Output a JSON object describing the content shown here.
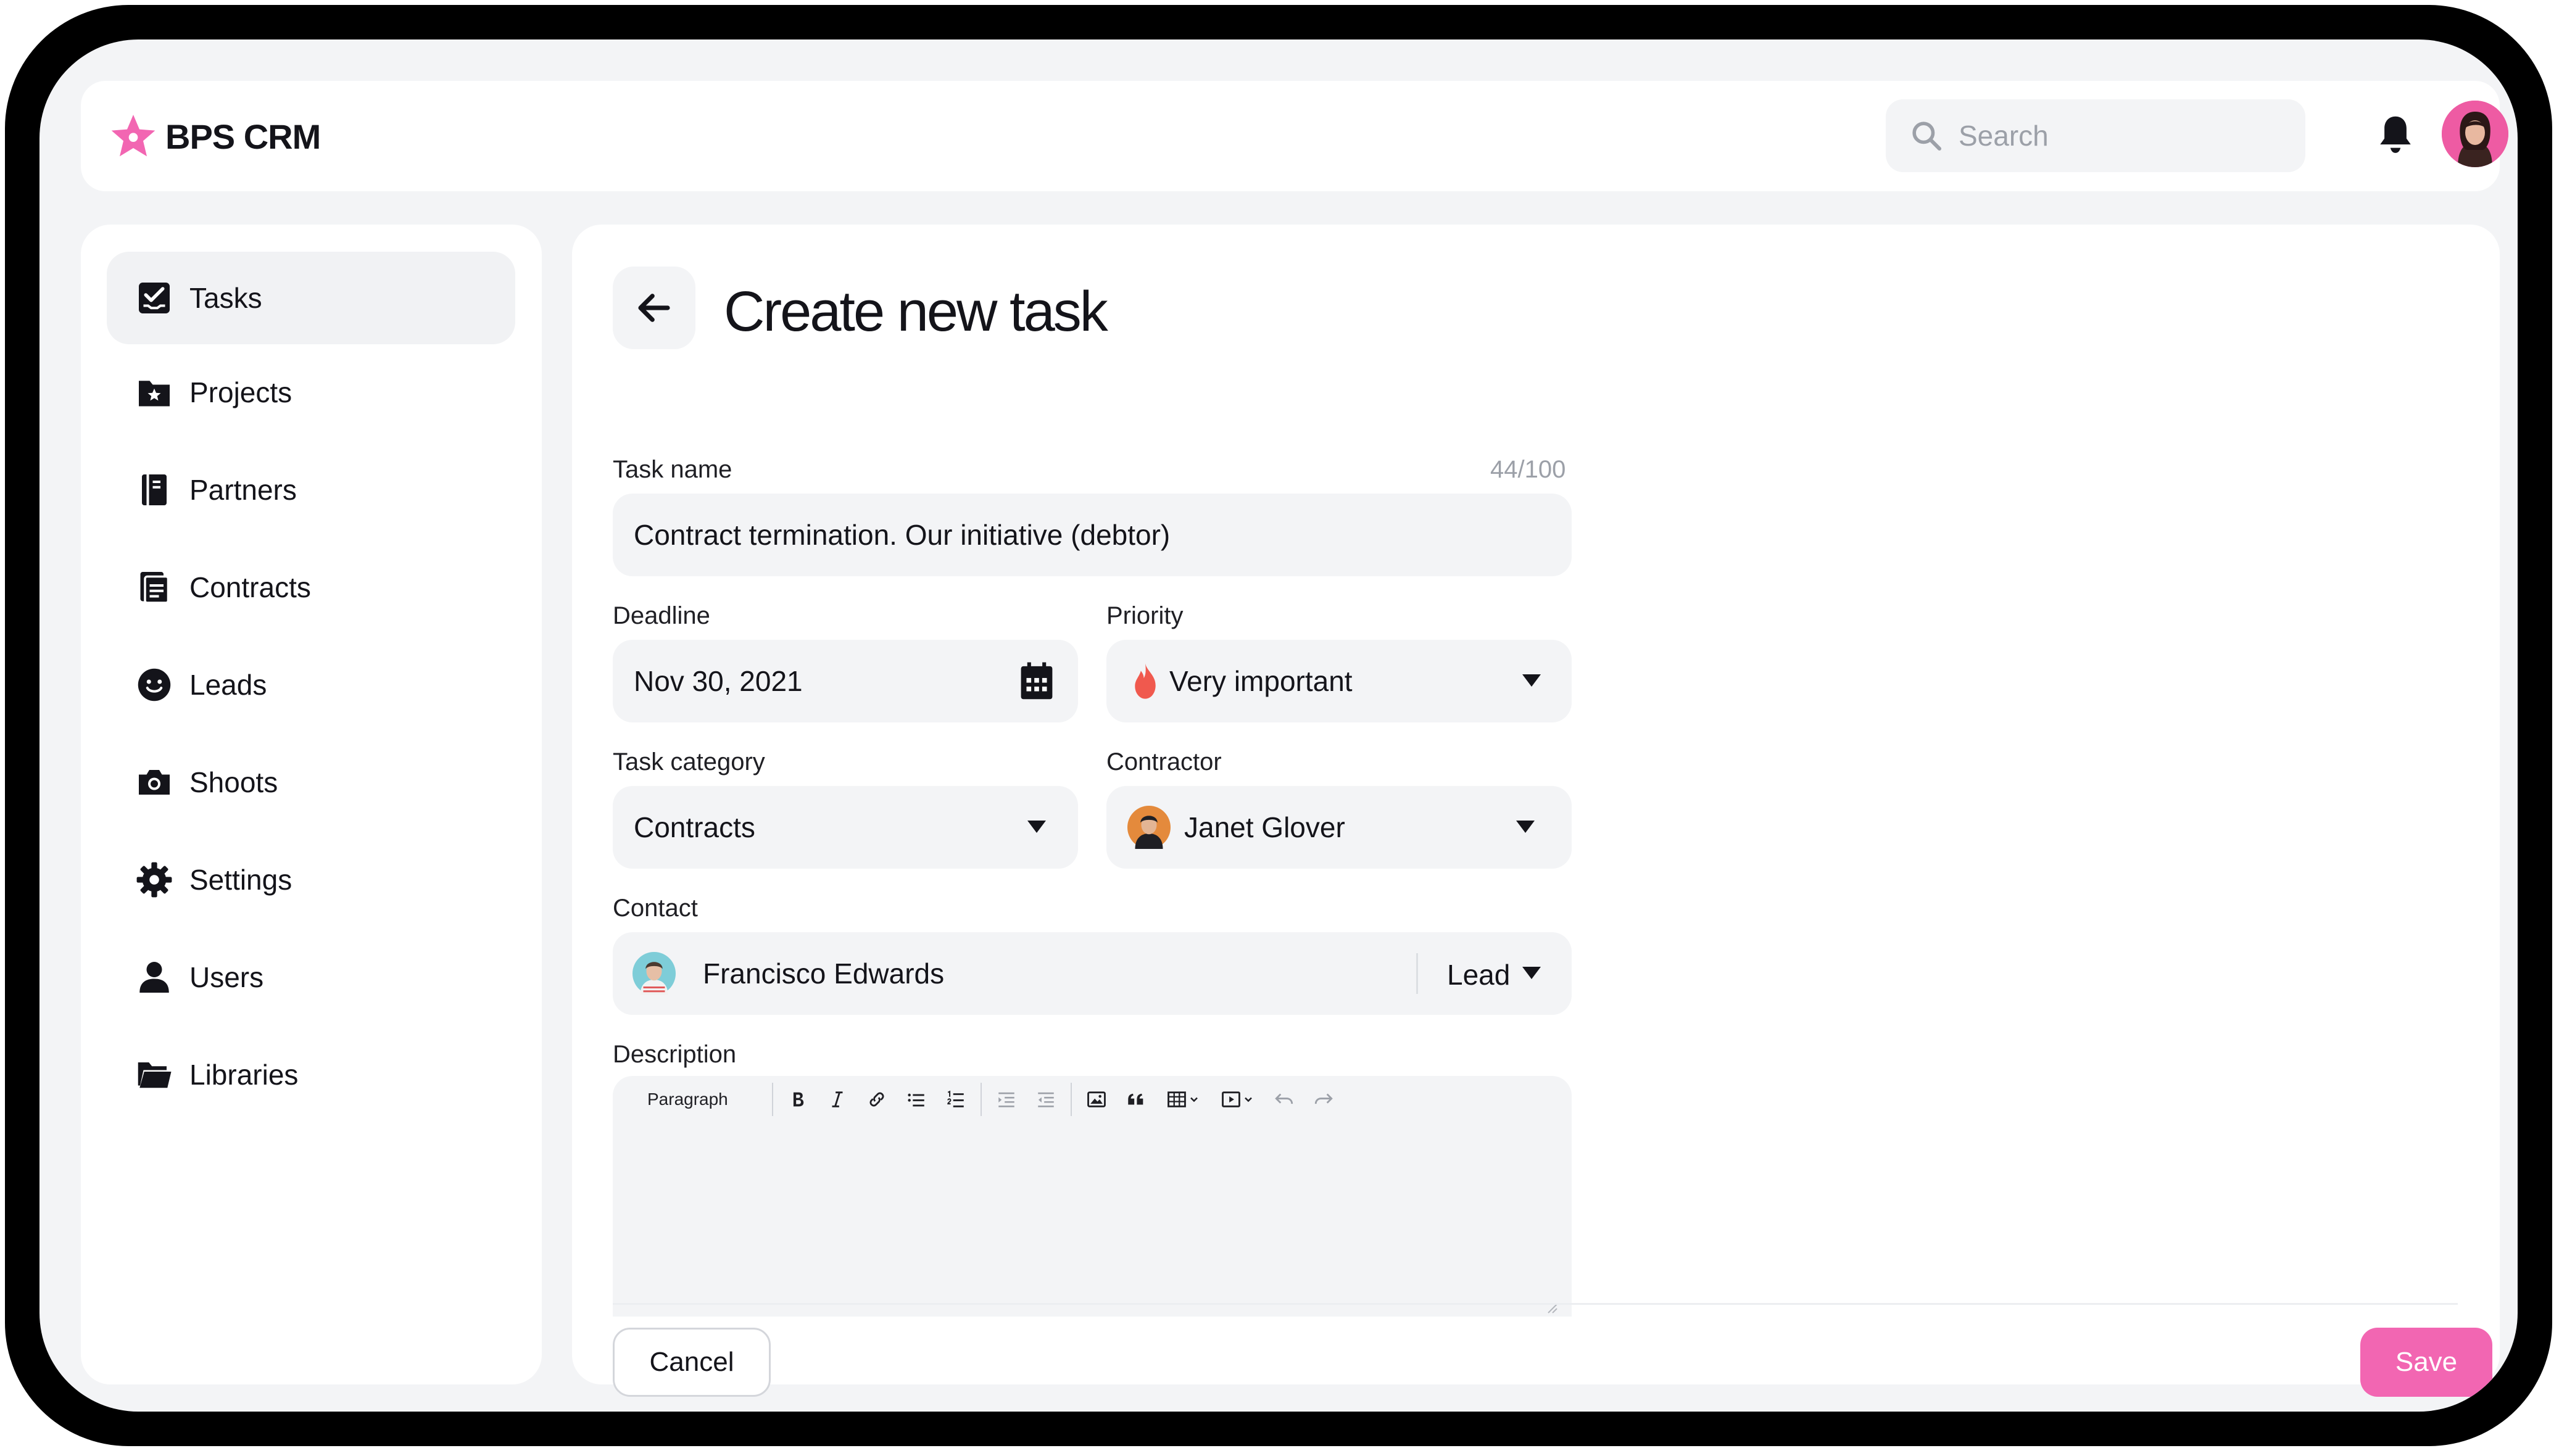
{
  "app": {
    "name": "BPS CRM",
    "brand_color": "#f266b2"
  },
  "header": {
    "search_placeholder": "Search"
  },
  "sidebar": {
    "items": [
      {
        "label": "Tasks",
        "icon": "tasks-icon",
        "active": true
      },
      {
        "label": "Projects",
        "icon": "projects-folder-icon"
      },
      {
        "label": "Partners",
        "icon": "partners-book-icon"
      },
      {
        "label": "Contracts",
        "icon": "contracts-document-icon"
      },
      {
        "label": "Leads",
        "icon": "leads-smile-icon"
      },
      {
        "label": "Shoots",
        "icon": "camera-icon"
      },
      {
        "label": "Settings",
        "icon": "gear-icon"
      },
      {
        "label": "Users",
        "icon": "user-icon"
      },
      {
        "label": "Libraries",
        "icon": "folder-open-icon"
      }
    ]
  },
  "form": {
    "title": "Create new task",
    "task_name": {
      "label": "Task name",
      "value": "Contract termination. Our initiative (debtor)",
      "counter": "44/100"
    },
    "deadline": {
      "label": "Deadline",
      "value": "Nov 30, 2021"
    },
    "priority": {
      "label": "Priority",
      "value": "Very important",
      "color": "#f0594e"
    },
    "task_category": {
      "label": "Task category",
      "value": "Contracts"
    },
    "contractor": {
      "label": "Contractor",
      "value": "Janet Glover"
    },
    "contact": {
      "label": "Contact",
      "name": "Francisco Edwards",
      "type": "Lead"
    },
    "description": {
      "label": "Description",
      "block_format": "Paragraph"
    }
  },
  "footer": {
    "cancel_label": "Cancel",
    "save_label": "Save"
  }
}
